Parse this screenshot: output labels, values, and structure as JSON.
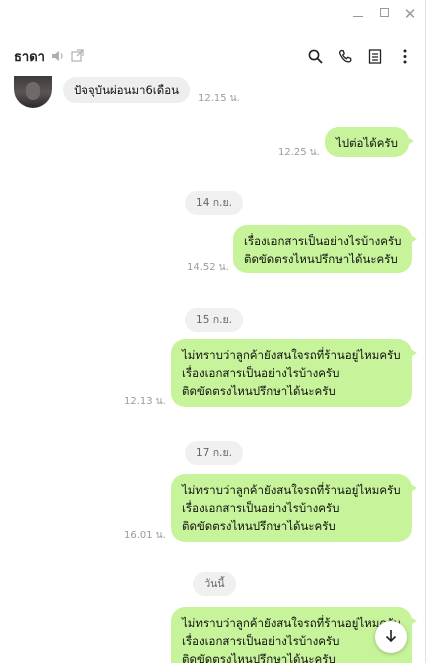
{
  "header": {
    "contact_name": "ธาดา"
  },
  "messages": {
    "m1": {
      "text": "ปัจจุบันผ่อนมา6เดือน",
      "time": "12.15 น."
    },
    "m2": {
      "text": "ไปต่อได้ครับ",
      "time": "12.25 น."
    },
    "d1": "14 ก.ย.",
    "m3": {
      "lines": [
        "เรื่องเอกสารเป็นอย่างไรบ้างครับ",
        "ติดขัดตรงไหนปรึกษาได้นะครับ"
      ],
      "time": "14.52 น."
    },
    "d2": "15 ก.ย.",
    "m4": {
      "lines": [
        "ไม่ทราบว่าลูกค้ายังสนใจรถที่ร้านอยู่ไหมครับ",
        "เรื่องเอกสารเป็นอย่างไรบ้างครับ",
        "ติดขัดตรงไหนปรึกษาได้นะครับ"
      ],
      "time": "12.13 น."
    },
    "d3": "17 ก.ย.",
    "m5": {
      "lines": [
        "ไม่ทราบว่าลูกค้ายังสนใจรถที่ร้านอยู่ไหมครับ",
        "เรื่องเอกสารเป็นอย่างไรบ้างครับ",
        "ติดขัดตรงไหนปรึกษาได้นะครับ"
      ],
      "time": "16.01 น."
    },
    "d4": "วันนี้",
    "m6": {
      "lines": [
        "ไม่ทราบว่าลูกค้ายังสนใจรถที่ร้านอยู่ไหมครับ",
        "เรื่องเอกสารเป็นอย่างไรบ้างครับ",
        "ติดขัดตรงไหนปรึกษาได้นะครับ"
      ]
    }
  },
  "colors": {
    "outgoing_bubble": "#c7f49a",
    "incoming_bubble": "#eeeeee",
    "date_pill": "#f0f0f0"
  },
  "icons": [
    "minimize-icon",
    "maximize-icon",
    "close-icon",
    "speaker-icon",
    "external-link-icon",
    "search-icon",
    "phone-icon",
    "notes-icon",
    "more-vertical-icon",
    "arrow-down-icon"
  ]
}
